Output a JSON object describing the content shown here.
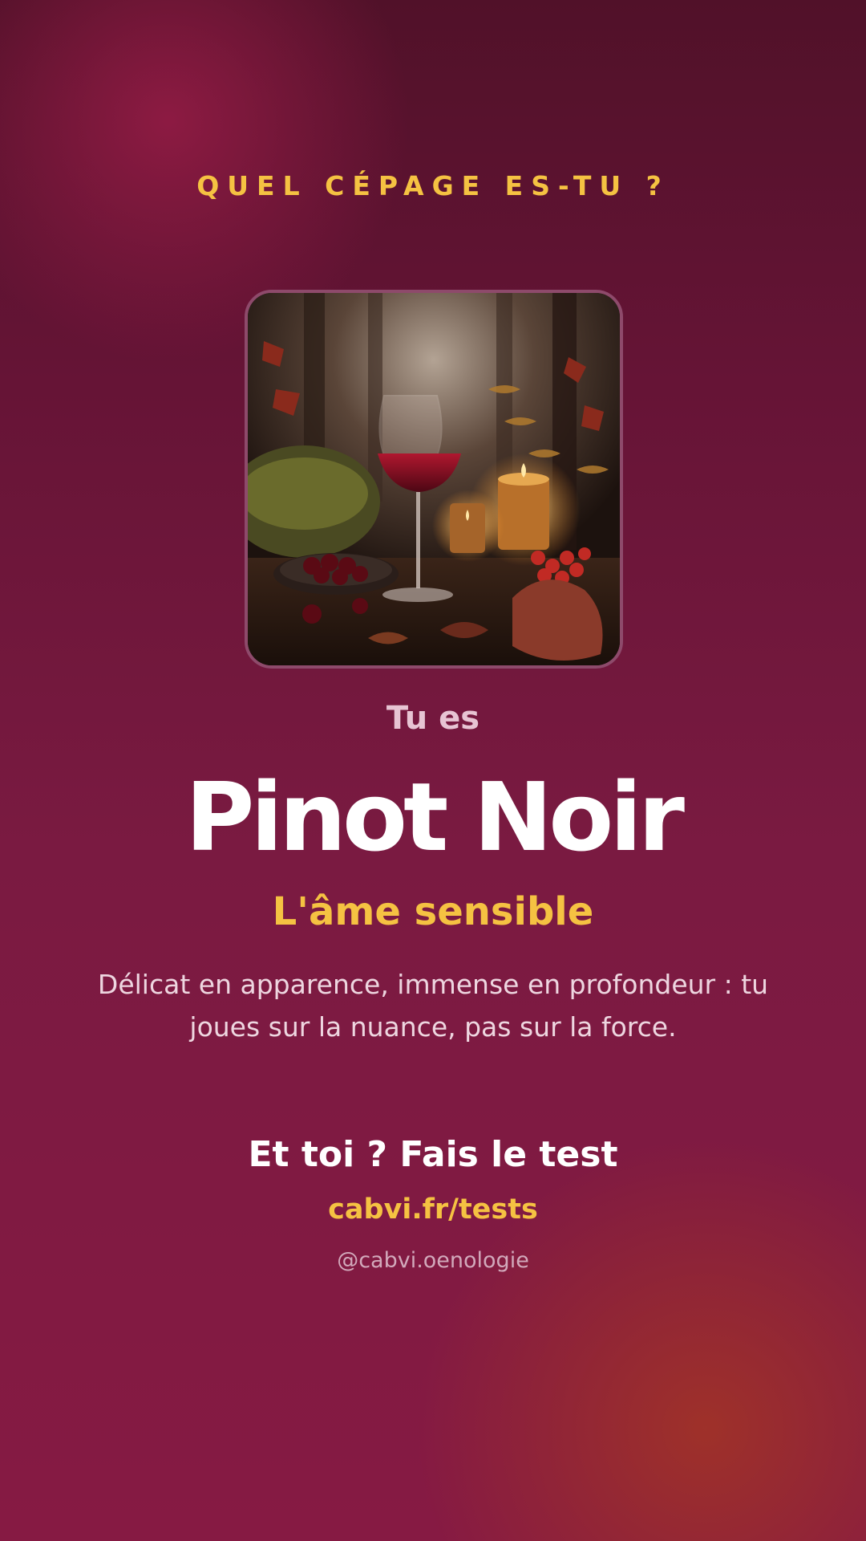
{
  "header": {
    "kicker": "QUEL CÉPAGE ES-TU ?"
  },
  "result": {
    "intro": "Tu es",
    "grape": "Pinot Noir",
    "tagline": "L'âme sensible",
    "description": "Délicat en apparence, immense en profondeur : tu joues sur la nuance, pas sur la force."
  },
  "footer": {
    "cta": "Et toi ? Fais le test",
    "link": "cabvi.fr/tests",
    "handle": "@cabvi.oenologie"
  },
  "colors": {
    "background_top": "#511129",
    "background_bottom": "#861a43",
    "accent": "#f5c242",
    "text": "#ffffff",
    "frame_border": "#8e4a6b"
  },
  "illustration": {
    "subject": "wine-glass-with-candles-and-berries"
  }
}
